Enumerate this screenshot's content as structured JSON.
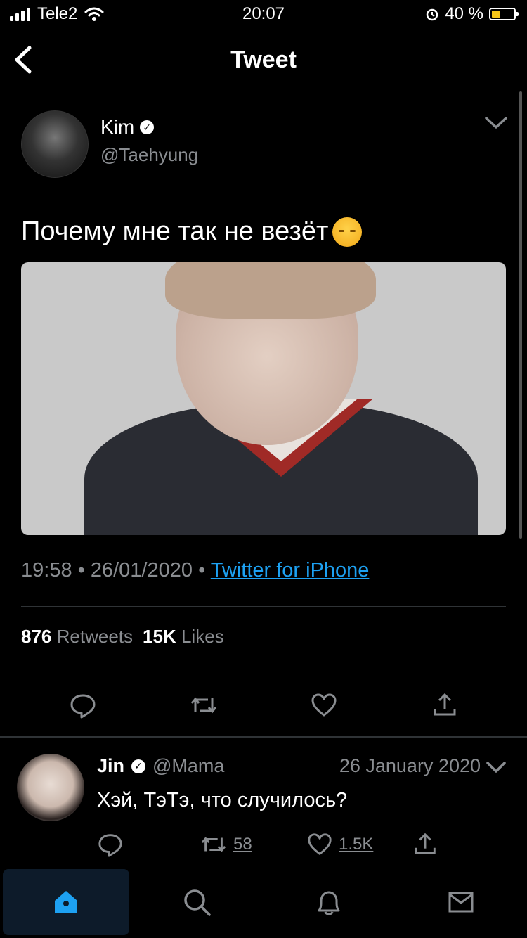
{
  "status_bar": {
    "carrier": "Tele2",
    "time": "20:07",
    "battery_percent_text": "40 %",
    "battery_fraction": 0.4
  },
  "nav": {
    "title": "Tweet"
  },
  "tweet": {
    "author_name": "Kim",
    "author_handle": "@Taehyung",
    "text": "Почему мне так не везёт",
    "time": "19:58",
    "date": "26/01/2020",
    "source": "Twitter for iPhone",
    "retweets_count": "876",
    "retweets_label": "Retweets",
    "likes_count": "15K",
    "likes_label": "Likes"
  },
  "reply": {
    "author_name": "Jin",
    "author_handle": "@Mama",
    "date": "26 January 2020",
    "text": "Хэй, ТэТэ, что случилось?",
    "retweets": "58",
    "likes": "1.5K"
  },
  "icons": {
    "verified": "verified-badge-icon",
    "reply": "comment-icon",
    "retweet": "retweet-icon",
    "like": "heart-icon",
    "share": "share-icon"
  },
  "colors": {
    "background": "#000000",
    "accent": "#1da1f2",
    "secondary_text": "#8a8d91",
    "battery_fill": "#f5c518"
  },
  "tabs": [
    "home",
    "search",
    "notifications",
    "messages"
  ]
}
